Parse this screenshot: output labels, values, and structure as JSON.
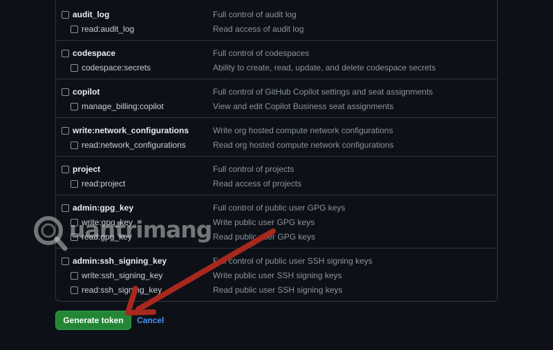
{
  "scope_groups": [
    {
      "rows": [
        {
          "name": "audit_log",
          "description": "Full control of audit log"
        },
        {
          "name": "read:audit_log",
          "description": "Read access of audit log"
        }
      ]
    },
    {
      "rows": [
        {
          "name": "codespace",
          "description": "Full control of codespaces"
        },
        {
          "name": "codespace:secrets",
          "description": "Ability to create, read, update, and delete codespace secrets"
        }
      ]
    },
    {
      "rows": [
        {
          "name": "copilot",
          "description": "Full control of GitHub Copilot settings and seat assignments"
        },
        {
          "name": "manage_billing:copilot",
          "description": "View and edit Copilot Business seat assignments"
        }
      ]
    },
    {
      "rows": [
        {
          "name": "write:network_configurations",
          "description": "Write org hosted compute network configurations"
        },
        {
          "name": "read:network_configurations",
          "description": "Read org hosted compute network configurations"
        }
      ]
    },
    {
      "rows": [
        {
          "name": "project",
          "description": "Full control of projects"
        },
        {
          "name": "read:project",
          "description": "Read access of projects"
        }
      ]
    },
    {
      "rows": [
        {
          "name": "admin:gpg_key",
          "description": "Full control of public user GPG keys"
        },
        {
          "name": "write:gpg_key",
          "description": "Write public user GPG keys"
        },
        {
          "name": "read:gpg_key",
          "description": "Read public user GPG keys"
        }
      ]
    },
    {
      "rows": [
        {
          "name": "admin:ssh_signing_key",
          "description": "Full control of public user SSH signing keys"
        },
        {
          "name": "write:ssh_signing_key",
          "description": "Write public user SSH signing keys"
        },
        {
          "name": "read:ssh_signing_key",
          "description": "Read public user SSH signing keys"
        }
      ]
    }
  ],
  "actions": {
    "generate_label": "Generate token",
    "cancel_label": "Cancel"
  },
  "watermark": {
    "text": "uantrimang",
    "icon": "magnifier-q-logo-icon"
  },
  "colors": {
    "background": "#0d1117",
    "border": "#30363d",
    "primary_button": "#238636",
    "link": "#4493f8",
    "arrow": "#a8281e"
  }
}
